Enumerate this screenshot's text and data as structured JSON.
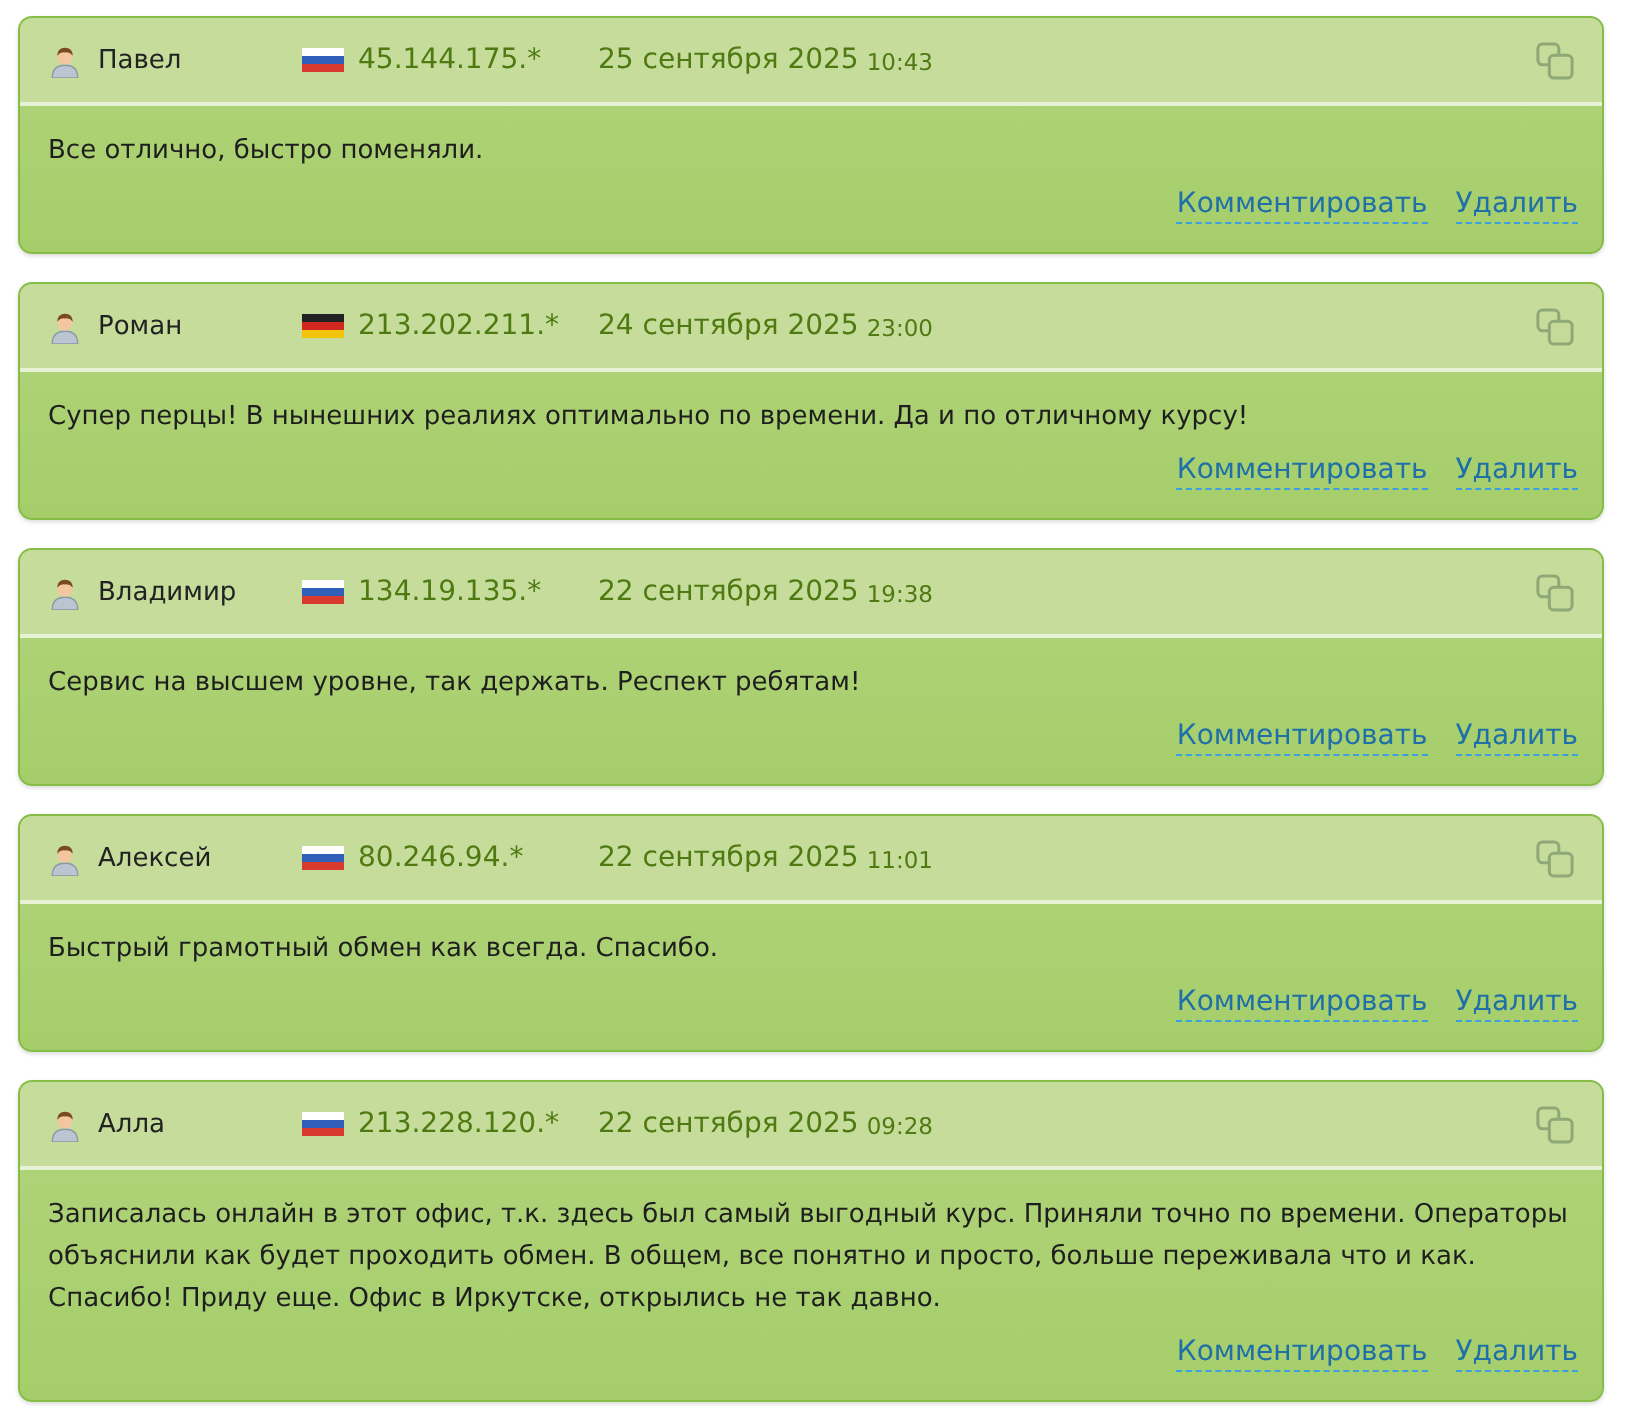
{
  "reviews": [
    {
      "author": "Павел",
      "flag": {
        "kind": "ru"
      },
      "ip": "45.144.175.*",
      "date": "25 сентября 2025",
      "time": "10:43",
      "text": "Все отлично, быстро поменяли.",
      "actions": [
        "Комментировать",
        "Удалить"
      ]
    },
    {
      "author": "Роман",
      "flag": {
        "kind": "de"
      },
      "ip": "213.202.211.*",
      "date": "24 сентября 2025",
      "time": "23:00",
      "text": "Супер перцы! В нынешних реалиях оптимально по времени. Да и по отличному курсу!",
      "actions": [
        "Комментировать",
        "Удалить"
      ]
    },
    {
      "author": "Владимир",
      "flag": {
        "kind": "ru"
      },
      "ip": "134.19.135.*",
      "date": "22 сентября 2025",
      "time": "19:38",
      "text": "Сервис на высшем уровне, так держать. Респект ребятам!",
      "actions": [
        "Комментировать",
        "Удалить"
      ]
    },
    {
      "author": "Алексей",
      "flag": {
        "kind": "ru"
      },
      "ip": "80.246.94.*",
      "date": "22 сентября 2025",
      "time": "11:01",
      "text": "Быстрый грамотный обмен как всегда. Спасибо.",
      "actions": [
        "Комментировать",
        "Удалить"
      ]
    },
    {
      "author": "Алла",
      "flag": {
        "kind": "ru"
      },
      "ip": "213.228.120.*",
      "date": "22 сентября 2025",
      "time": "09:28",
      "text": "Записалась онлайн в этот офис, т.к. здесь был самый выгодный курс. Приняли точно по времени. Операторы объяснили как будет проходить обмен. В общем, все понятно и просто, больше переживала что и как. Спасибо! Приду еще. Офис в Иркутске, открылись не так давно.",
      "actions": [
        "Комментировать",
        "Удалить"
      ]
    }
  ]
}
